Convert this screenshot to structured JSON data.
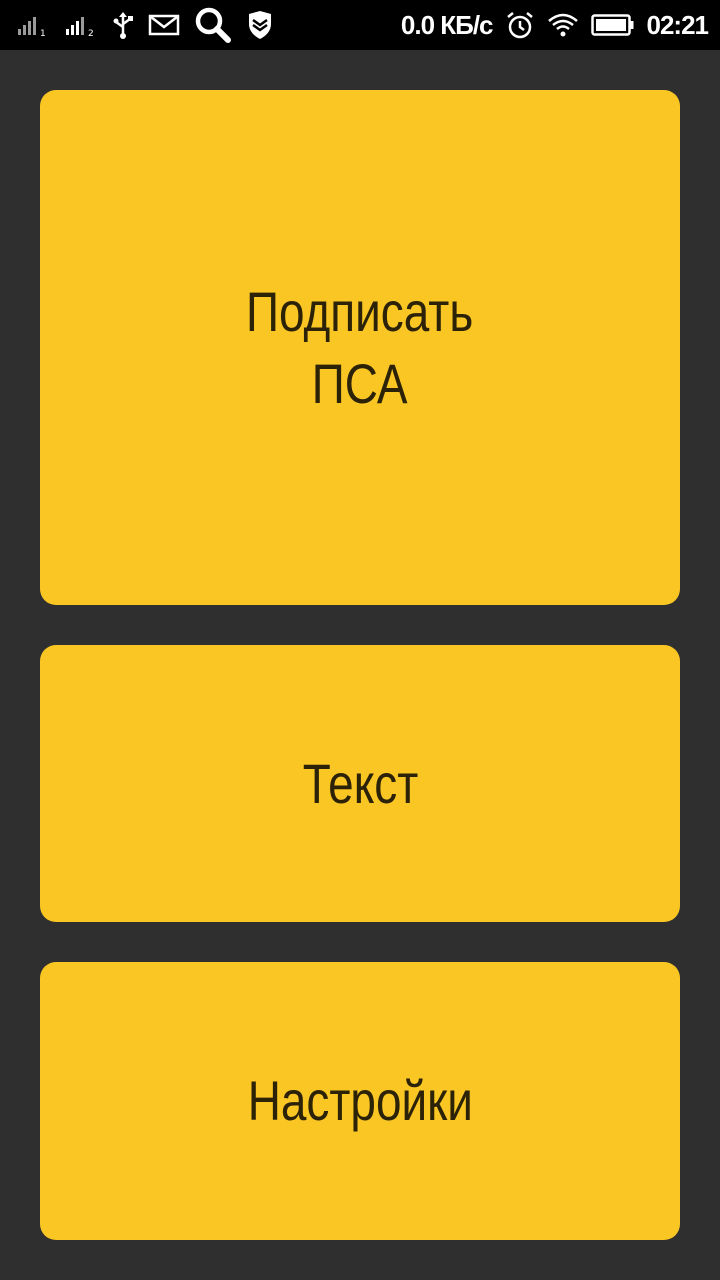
{
  "status_bar": {
    "network_speed": "0.0 КБ/с",
    "time": "02:21",
    "icons": [
      "signal-sim1-icon",
      "signal-sim2-icon",
      "usb-icon",
      "mail-icon",
      "search-icon",
      "shield-icon",
      "alarm-icon",
      "wifi-icon",
      "battery-icon"
    ]
  },
  "main": {
    "sign_button_label": "Подписать\nПСА",
    "text_button_label": "Текст",
    "settings_button_label": "Настройки"
  },
  "colors": {
    "background": "#2f2f2f",
    "tile": "#f9c623",
    "tile_text": "#2b2207",
    "status_bar": "#000000"
  }
}
